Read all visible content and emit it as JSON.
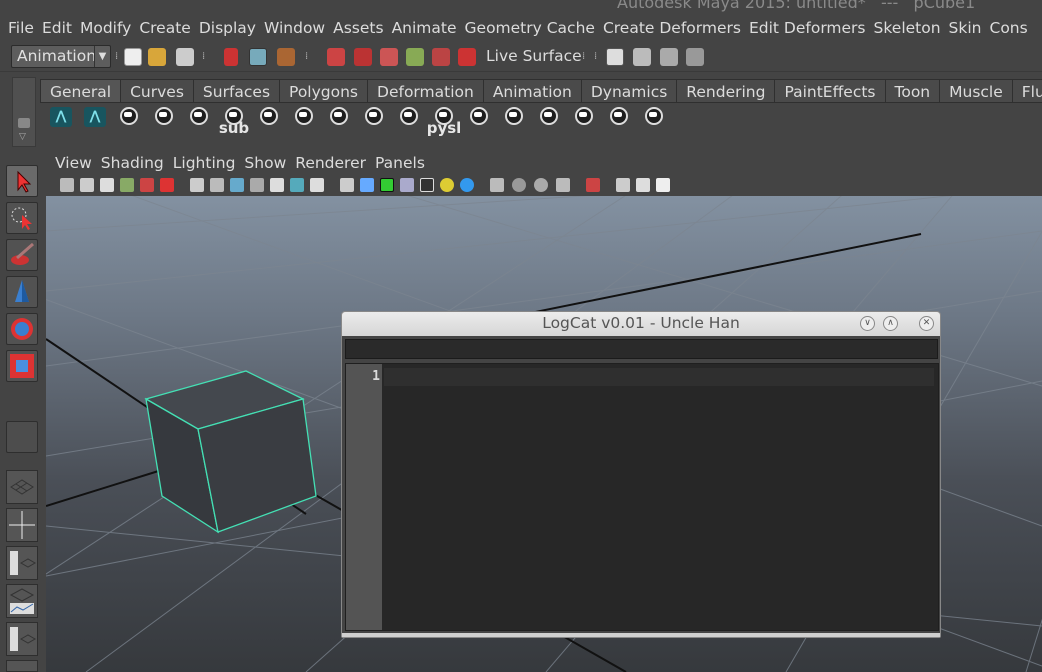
{
  "window_title": "Autodesk Maya 2015: untitled*   ---   pCube1",
  "menubar": [
    "File",
    "Edit",
    "Modify",
    "Create",
    "Display",
    "Window",
    "Assets",
    "Animate",
    "Geometry Cache",
    "Create Deformers",
    "Edit Deformers",
    "Skeleton",
    "Skin",
    "Cons"
  ],
  "status_line": {
    "mode": "Animation",
    "live_surface": "Live Surface"
  },
  "shelf": {
    "tabs": [
      "General",
      "Curves",
      "Surfaces",
      "Polygons",
      "Deformation",
      "Animation",
      "Dynamics",
      "Rendering",
      "PaintEffects",
      "Toon",
      "Muscle",
      "Fluids"
    ],
    "buttons": [
      {
        "icon": "maya-icon",
        "label": ""
      },
      {
        "icon": "maya-icon",
        "label": ""
      },
      {
        "icon": "python-icon",
        "label": ""
      },
      {
        "icon": "python-icon",
        "label": ""
      },
      {
        "icon": "python-icon",
        "label": ""
      },
      {
        "icon": "python-icon",
        "label": "sub"
      },
      {
        "icon": "python-icon",
        "label": ""
      },
      {
        "icon": "python-icon",
        "label": ""
      },
      {
        "icon": "python-icon",
        "label": ""
      },
      {
        "icon": "python-icon",
        "label": ""
      },
      {
        "icon": "python-icon",
        "label": ""
      },
      {
        "icon": "python-icon",
        "label": "pysl"
      },
      {
        "icon": "python-icon",
        "label": ""
      },
      {
        "icon": "python-icon",
        "label": ""
      },
      {
        "icon": "python-icon",
        "label": ""
      },
      {
        "icon": "python-icon",
        "label": ""
      },
      {
        "icon": "python-icon",
        "label": ""
      },
      {
        "icon": "python-icon",
        "label": ""
      }
    ]
  },
  "panel_menu": [
    "View",
    "Shading",
    "Lighting",
    "Show",
    "Renderer",
    "Panels"
  ],
  "logcat": {
    "title": "LogCat v0.01 - Uncle Han",
    "input_value": "",
    "line_number": "1"
  },
  "colors": {
    "ui_background": "#444444",
    "selection_wireframe": "#44e0b4",
    "viewport_top": "#8391a1",
    "viewport_bottom": "#36393d"
  }
}
